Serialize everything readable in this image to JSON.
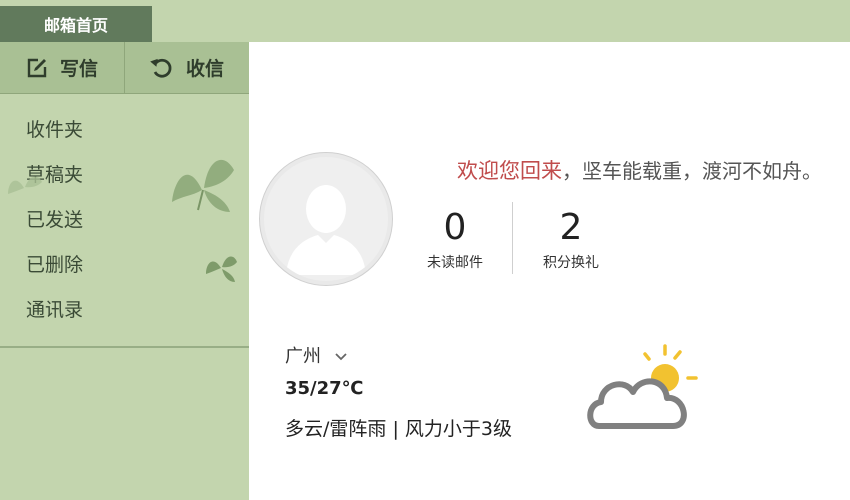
{
  "header": {
    "home_tab": "邮箱首页"
  },
  "toolbar": {
    "compose_label": "写信",
    "receive_label": "收信"
  },
  "sidebar": {
    "folders": [
      {
        "label": "收件夹"
      },
      {
        "label": "草稿夹"
      },
      {
        "label": "已发送"
      },
      {
        "label": "已删除"
      },
      {
        "label": "通讯录"
      }
    ]
  },
  "welcome": {
    "greeting": "欢迎您回来",
    "motto": "，坚车能载重，渡河不如舟。"
  },
  "stats": {
    "unread": {
      "value": "0",
      "label": "未读邮件"
    },
    "points": {
      "value": "2",
      "label": "积分换礼"
    }
  },
  "weather": {
    "city": "广州",
    "temperature": "35/27℃",
    "description": "多云/雷阵雨 | 风力小于3级",
    "icon": "partly-cloudy-icon"
  },
  "colors": {
    "sidebar_bg": "#c3d5ae",
    "home_tab_bg": "#617a5c",
    "greeting": "#c04c4c"
  }
}
